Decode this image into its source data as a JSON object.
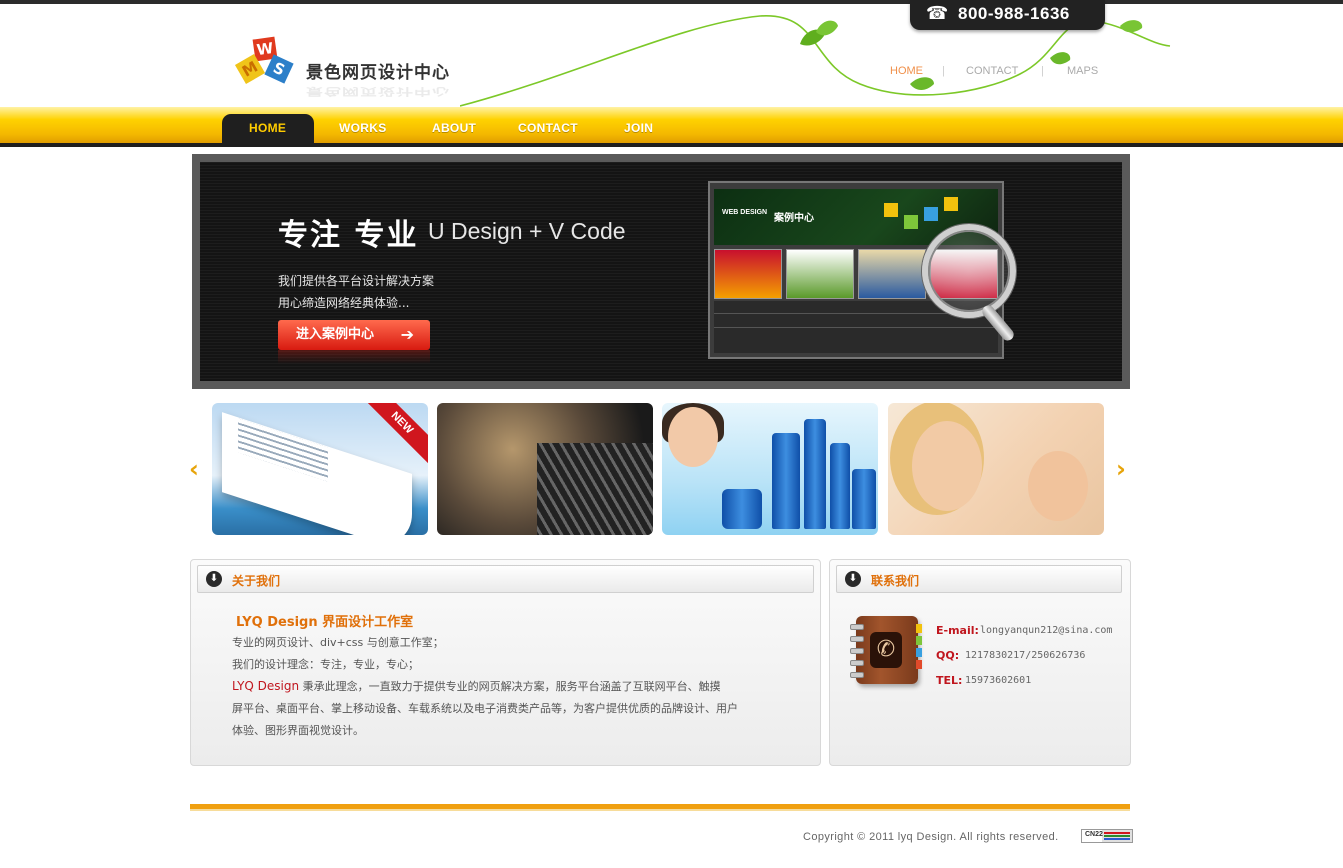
{
  "header": {
    "logo_text": "景色网页设计中心",
    "logo_letters": [
      "W",
      "M",
      "S"
    ],
    "phone": "800-988-1636",
    "top_nav": [
      "HOME",
      "CONTACT",
      "MAPS"
    ]
  },
  "nav": {
    "items": [
      "HOME",
      "WORKS",
      "ABOUT",
      "CONTACT",
      "JOIN"
    ],
    "active": "HOME"
  },
  "banner": {
    "title_cn": "专注 专业",
    "title_en": "U Design + V Code",
    "line1": "我们提供各平台设计解决方案",
    "line2": "用心缔造网络经典体验...",
    "button": "进入案例中心",
    "screen_logo": "WEB DESIGN",
    "screen_title": "案例中心"
  },
  "carousel": {
    "prev_icon": "chevron-left-icon",
    "next_icon": "chevron-right-icon",
    "new_label": "NEW",
    "items": [
      "cruise-ship",
      "pearls",
      "cosmetics",
      "mother-and-child"
    ]
  },
  "about": {
    "heading": "关于我们",
    "title": "LYQ Design  界面设计工作室",
    "line1": "专业的网页设计、div+css 与创意工作室；",
    "line2": "我们的设计理念：专注，专业，专心；",
    "brand": "LYQ Design",
    "line3_rest": "  秉承此理念，一直致力于提供专业的网页解决方案，服务平台涵盖了互联网平台、触摸",
    "line4": "屏平台、桌面平台、掌上移动设备、车载系统以及电子消费类产品等，为客户提供优质的品牌设计、用户",
    "line5": "体验、图形界面视觉设计。"
  },
  "contact": {
    "heading": "联系我们",
    "email_label": "E-mail:",
    "email": "longyanqun212@sina.com",
    "qq_label": "QQ:",
    "qq": "1217830217/250626736",
    "tel_label": "TEL:",
    "tel": "15973602601"
  },
  "footer": {
    "copyright": "Copyright © 2011 lyq Design. All rights reserved.",
    "badge": "CN22"
  },
  "colors": {
    "accent_orange": "#e0700a",
    "nav_yellow": "#ffd200",
    "brand_red": "#c0161e",
    "footer_bar": "#f0a010"
  }
}
